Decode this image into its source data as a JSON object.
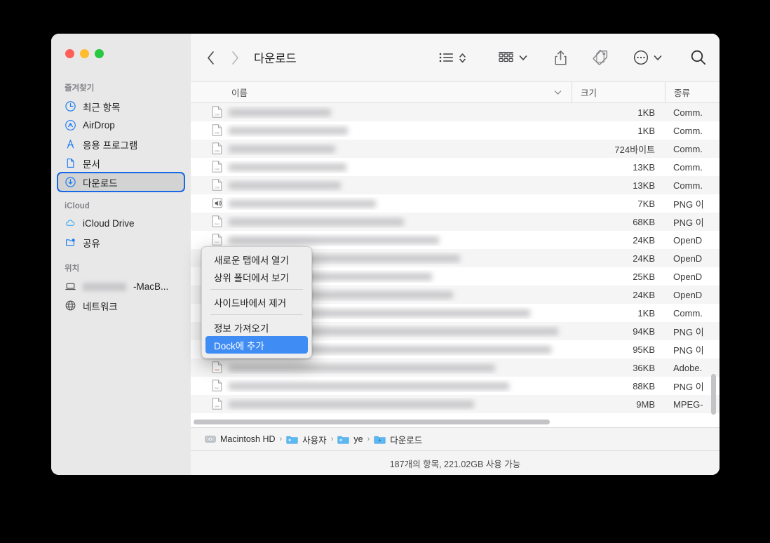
{
  "window": {
    "traffic_lights": [
      "close",
      "minimize",
      "zoom"
    ],
    "colors": {
      "close": "#ff5f57",
      "minimize": "#febc2e",
      "zoom": "#28c840",
      "accent": "#3f8cf4",
      "selection_outline": "#1668e3",
      "sidebar_bg": "#e9e8e8"
    }
  },
  "toolbar": {
    "title": "다운로드",
    "back_icon": "chevron-left-icon",
    "forward_icon": "chevron-right-icon",
    "view_list_icon": "list-view-icon",
    "view_sort_icon": "sort-chevrons-icon",
    "group_icon": "group-grid-icon",
    "group_chevron": "chevron-down-icon",
    "share_icon": "share-icon",
    "tag_icon": "tag-icon",
    "more_icon": "ellipsis-circle-icon",
    "more_chevron": "chevron-down-icon",
    "search_icon": "search-icon"
  },
  "sidebar": {
    "sections": [
      {
        "title": "즐겨찾기",
        "items": [
          {
            "label": "최근 항목",
            "icon": "clock-icon",
            "selected": false
          },
          {
            "label": "AirDrop",
            "icon": "airdrop-icon",
            "selected": false
          },
          {
            "label": "응용 프로그램",
            "icon": "applications-icon",
            "selected": false
          },
          {
            "label": "문서",
            "icon": "document-icon",
            "selected": false
          },
          {
            "label": "다운로드",
            "icon": "downloads-icon",
            "selected": true
          }
        ]
      },
      {
        "title": "iCloud",
        "items": [
          {
            "label": "iCloud Drive",
            "icon": "cloud-icon",
            "selected": false
          },
          {
            "label": "공유",
            "icon": "shared-folder-icon",
            "selected": false
          }
        ]
      },
      {
        "title": "위치",
        "items": [
          {
            "label": "-MacB...",
            "icon": "laptop-icon",
            "selected": false,
            "redacted_prefix": true
          },
          {
            "label": "네트워크",
            "icon": "globe-icon",
            "selected": false
          }
        ]
      }
    ]
  },
  "columns": {
    "name": "이름",
    "size": "크기",
    "kind": "종류",
    "sort_chevron": "chevron-down-icon"
  },
  "files": [
    {
      "name_redacted": true,
      "name_width": 146,
      "icon": "csv-file-icon",
      "size": "1KB",
      "kind": "Comm."
    },
    {
      "name_redacted": true,
      "name_width": 170,
      "icon": "csv-file-icon",
      "size": "1KB",
      "kind": "Comm."
    },
    {
      "name_redacted": true,
      "name_width": 152,
      "icon": "csv-file-icon",
      "size": "724바이트",
      "kind": "Comm."
    },
    {
      "name_redacted": true,
      "name_width": 168,
      "icon": "csv-file-icon",
      "size": "13KB",
      "kind": "Comm."
    },
    {
      "name_redacted": true,
      "name_width": 160,
      "icon": "csv-file-icon",
      "size": "13KB",
      "kind": "Comm."
    },
    {
      "name_redacted": true,
      "name_width": 210,
      "icon": "audio-file-icon",
      "size": "7KB",
      "kind": "PNG 이"
    },
    {
      "name_redacted": true,
      "name_width": 250,
      "icon": "image-file-icon",
      "size": "68KB",
      "kind": "PNG 이"
    },
    {
      "name_redacted": true,
      "name_width": 300,
      "icon": "doc-file-icon",
      "size": "24KB",
      "kind": "OpenD"
    },
    {
      "name_redacted": true,
      "name_width": 330,
      "icon": "doc-file-icon",
      "size": "24KB",
      "kind": "OpenD"
    },
    {
      "name_redacted": true,
      "name_width": 290,
      "icon": "doc-file-icon",
      "size": "25KB",
      "kind": "OpenD"
    },
    {
      "name_redacted": true,
      "name_width": 320,
      "icon": "doc-file-icon",
      "size": "24KB",
      "kind": "OpenD"
    },
    {
      "name_redacted": true,
      "name_width": 430,
      "icon": "csv-file-icon",
      "size": "1KB",
      "kind": "Comm."
    },
    {
      "name_redacted": true,
      "name_width": 470,
      "icon": "image-file-icon",
      "size": "94KB",
      "kind": "PNG 이"
    },
    {
      "name_redacted": true,
      "name_width": 460,
      "icon": "image-file-icon",
      "size": "95KB",
      "kind": "PNG 이"
    },
    {
      "name_redacted": true,
      "name_width": 380,
      "icon": "pdf-file-icon",
      "size": "36KB",
      "kind": "Adobe."
    },
    {
      "name_redacted": true,
      "name_width": 400,
      "icon": "image-file-icon",
      "size": "88KB",
      "kind": "PNG 이"
    },
    {
      "name_redacted": true,
      "name_width": 350,
      "icon": "video-file-icon",
      "size": "9MB",
      "kind": "MPEG-"
    }
  ],
  "context_menu": {
    "items": [
      {
        "label": "새로운 탭에서 열기",
        "highlighted": false,
        "separator_after": false
      },
      {
        "label": "상위 폴더에서 보기",
        "highlighted": false,
        "separator_after": true
      },
      {
        "label": "사이드바에서 제거",
        "highlighted": false,
        "separator_after": true
      },
      {
        "label": "정보 가져오기",
        "highlighted": false,
        "separator_after": false
      },
      {
        "label": "Dock에 추가",
        "highlighted": true,
        "separator_after": false
      }
    ]
  },
  "pathbar": {
    "crumbs": [
      {
        "label": "Macintosh HD",
        "icon": "harddisk-icon"
      },
      {
        "label": "사용자",
        "icon": "folder-icon"
      },
      {
        "label": "ye",
        "icon": "folder-icon"
      },
      {
        "label": "다운로드",
        "icon": "downloads-folder-icon"
      }
    ],
    "separator": "›"
  },
  "statusbar": {
    "text": "187개의 항목, 221.02GB 사용 가능"
  },
  "scrollbars": {
    "horizontal": "h-scrollbar",
    "vertical": "v-scrollbar"
  }
}
